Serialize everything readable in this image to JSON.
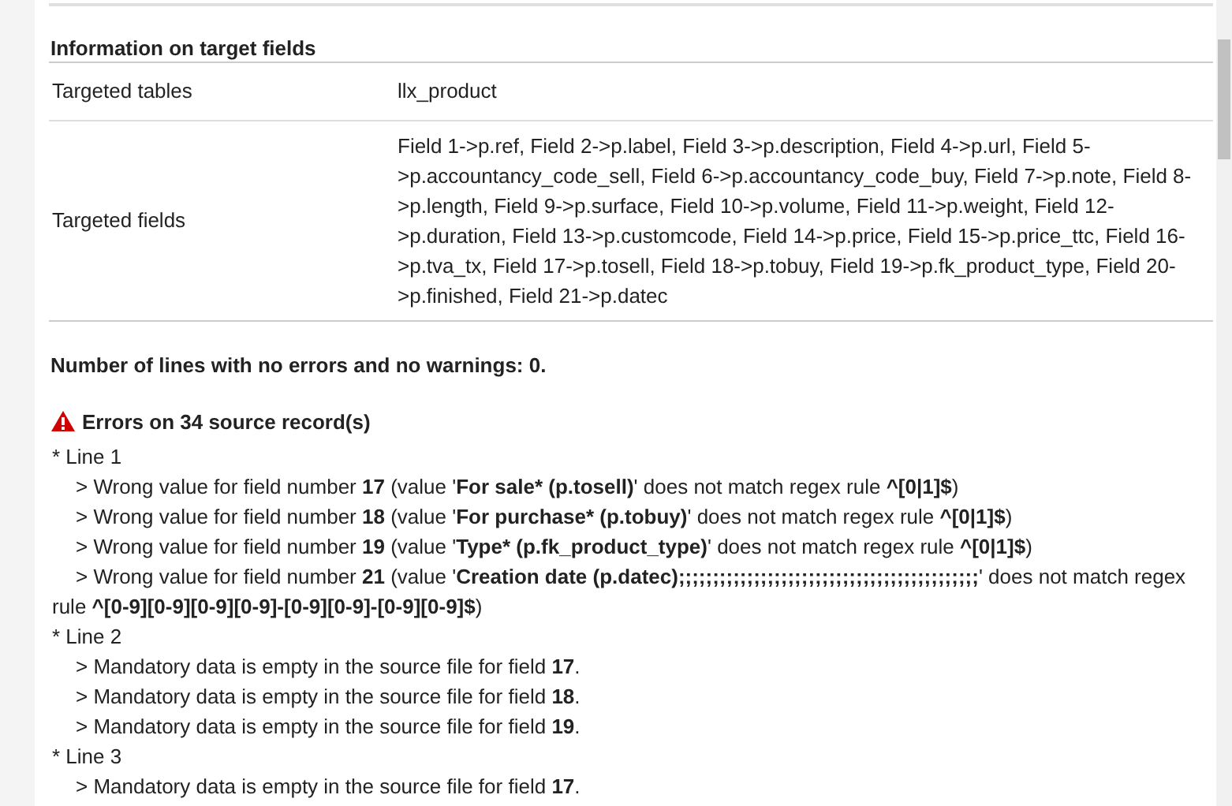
{
  "section_title": "Information on target fields",
  "table": {
    "rows": [
      {
        "label": "Targeted tables",
        "value": "llx_product"
      },
      {
        "label": "Targeted fields",
        "value": "Field 1->p.ref, Field 2->p.label, Field 3->p.description, Field 4->p.url, Field 5->p.accountancy_code_sell, Field 6->p.accountancy_code_buy, Field 7->p.note, Field 8->p.length, Field 9->p.surface, Field 10->p.volume, Field 11->p.weight, Field 12->p.duration, Field 13->p.customcode, Field 14->p.price, Field 15->p.price_ttc, Field 16->p.tva_tx, Field 17->p.tosell, Field 18->p.tobuy, Field 19->p.fk_product_type, Field 20->p.finished, Field 21->p.datec"
      }
    ]
  },
  "summary": "Number of lines with no errors and no warnings: 0.",
  "errors": {
    "title": "Errors on 34 source record(s)",
    "lines": [
      {
        "label": "* Line 1",
        "messages": [
          [
            {
              "text": "> Wrong value for field number ",
              "bold": false
            },
            {
              "text": "17",
              "bold": true
            },
            {
              "text": " (value '",
              "bold": false
            },
            {
              "text": "For sale* (p.tosell)",
              "bold": true
            },
            {
              "text": "' does not match regex rule ",
              "bold": false
            },
            {
              "text": "^[0|1]$",
              "bold": true
            },
            {
              "text": ")",
              "bold": false
            }
          ],
          [
            {
              "text": "> Wrong value for field number ",
              "bold": false
            },
            {
              "text": "18",
              "bold": true
            },
            {
              "text": " (value '",
              "bold": false
            },
            {
              "text": "For purchase* (p.tobuy)",
              "bold": true
            },
            {
              "text": "' does not match regex rule ",
              "bold": false
            },
            {
              "text": "^[0|1]$",
              "bold": true
            },
            {
              "text": ")",
              "bold": false
            }
          ],
          [
            {
              "text": "> Wrong value for field number ",
              "bold": false
            },
            {
              "text": "19",
              "bold": true
            },
            {
              "text": " (value '",
              "bold": false
            },
            {
              "text": "Type* (p.fk_product_type)",
              "bold": true
            },
            {
              "text": "' does not match regex rule ",
              "bold": false
            },
            {
              "text": "^[0|1]$",
              "bold": true
            },
            {
              "text": ")",
              "bold": false
            }
          ],
          [
            {
              "text": "> Wrong value for field number ",
              "bold": false
            },
            {
              "text": "21",
              "bold": true
            },
            {
              "text": " (value '",
              "bold": false
            },
            {
              "text": "Creation date (p.datec);;;;;;;;;;;;;;;;;;;;;;;;;;;;;;;;;;;;;;;;;;;;",
              "bold": true
            },
            {
              "text": "' does not match regex rule ",
              "bold": false
            },
            {
              "text": "^[0-9][0-9][0-9][0-9]-[0-9][0-9]-[0-9][0-9]$",
              "bold": true
            },
            {
              "text": ")",
              "bold": false
            }
          ]
        ]
      },
      {
        "label": "* Line 2",
        "messages": [
          [
            {
              "text": "> Mandatory data is empty in the source file for field ",
              "bold": false
            },
            {
              "text": "17",
              "bold": true
            },
            {
              "text": ".",
              "bold": false
            }
          ],
          [
            {
              "text": "> Mandatory data is empty in the source file for field ",
              "bold": false
            },
            {
              "text": "18",
              "bold": true
            },
            {
              "text": ".",
              "bold": false
            }
          ],
          [
            {
              "text": "> Mandatory data is empty in the source file for field ",
              "bold": false
            },
            {
              "text": "19",
              "bold": true
            },
            {
              "text": ".",
              "bold": false
            }
          ]
        ]
      },
      {
        "label": "* Line 3",
        "messages": [
          [
            {
              "text": "> Mandatory data is empty in the source file for field ",
              "bold": false
            },
            {
              "text": "17",
              "bold": true
            },
            {
              "text": ".",
              "bold": false
            }
          ]
        ]
      }
    ]
  }
}
